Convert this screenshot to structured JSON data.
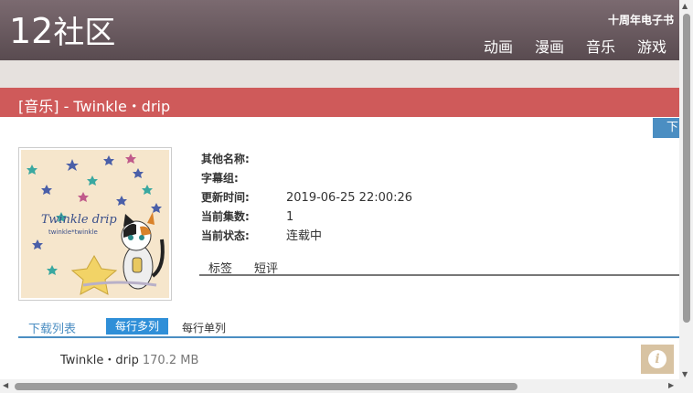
{
  "header": {
    "logo_num": "12",
    "logo_text": "社区",
    "anniversary": "十周年电子书",
    "nav": [
      "动画",
      "漫画",
      "音乐",
      "游戏"
    ]
  },
  "title": "[音乐] - Twinkle・drip",
  "download_tab": "下",
  "cover": {
    "title_text": "Twinkle drip",
    "subtitle_text": "twinkle*twinkle"
  },
  "info": [
    {
      "label": "其他名称:",
      "value": ""
    },
    {
      "label": "字幕组:",
      "value": ""
    },
    {
      "label": "更新时间:",
      "value": "2019-06-25 22:00:26"
    },
    {
      "label": "当前集数:",
      "value": "1"
    },
    {
      "label": "当前状态:",
      "value": "连载中"
    }
  ],
  "subtabs": [
    "标签",
    "短评"
  ],
  "download_list": {
    "title": "下载列表",
    "multi": "每行多列",
    "single": "每行单列"
  },
  "files": [
    {
      "name": "Twinkle・drip",
      "size": "170.2 MB"
    }
  ],
  "info_icon": "i",
  "colors": {
    "header": "#6a5a60",
    "title_bar": "#cf5a5a",
    "accent_blue": "#4b8ec2"
  }
}
